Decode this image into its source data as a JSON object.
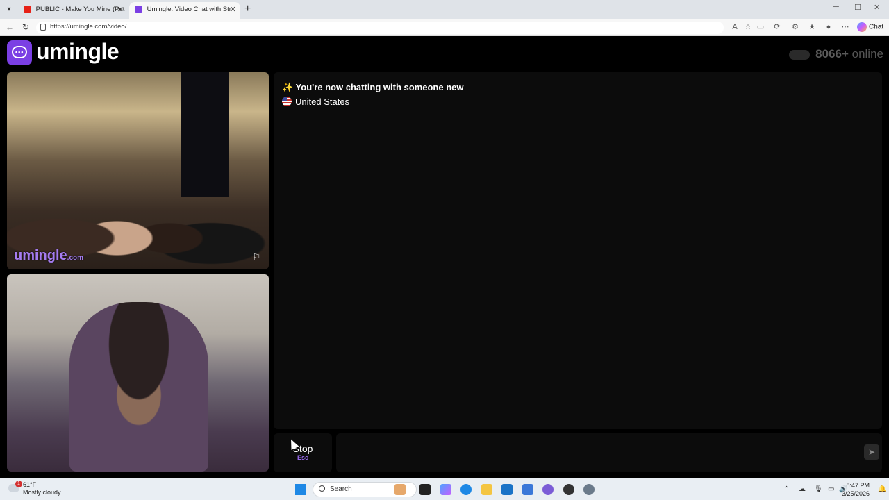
{
  "browser": {
    "tabs": [
      {
        "title": "PUBLIC - Make You Mine (Put",
        "active": false
      },
      {
        "title": "Umingle: Video Chat with Str",
        "active": true
      }
    ],
    "url": "https://umingle.com/video/",
    "chat_label": "Chat"
  },
  "site": {
    "logo_text": "umingle",
    "online_count": "8066+",
    "online_label": "online"
  },
  "videos": {
    "watermark": "umingle",
    "watermark_suffix": ".com"
  },
  "chat": {
    "system_message": "You're now chatting with someone new",
    "country": "United States",
    "stop_label": "Stop",
    "stop_hint": "Esc",
    "input_value": "",
    "input_placeholder": ""
  },
  "taskbar": {
    "weather_temp": "61°F",
    "weather_desc": "Mostly cloudy",
    "weather_badge": "1",
    "search_label": "Search",
    "time": "8:47 PM",
    "date": "3/25/2026"
  },
  "colors": {
    "brand_purple": "#7b3fe4",
    "watermark_purple": "#a57cf0"
  }
}
